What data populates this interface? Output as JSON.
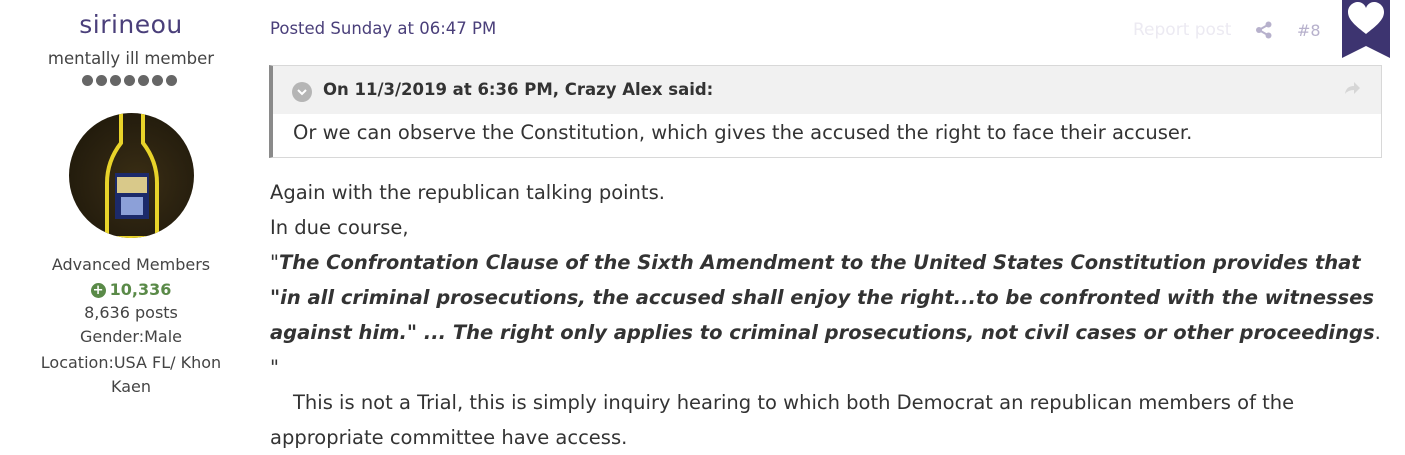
{
  "author": {
    "name": "sirineou",
    "title": "mentally ill member",
    "pips": 7,
    "group": "Advanced Members",
    "reputation": "10,336",
    "posts": "8,636 posts",
    "gender": "Gender:Male",
    "location": "Location:USA FL/ Khon Kaen"
  },
  "post": {
    "posted": "Posted Sunday at 06:47 PM",
    "report_label": "Report post",
    "number": "#8",
    "quote": {
      "citation": "On 11/3/2019 at 6:36 PM, Crazy Alex said:",
      "text": "Or we can observe the Constitution, which gives the accused the right to face their accuser."
    },
    "body": {
      "line1": "Again with the republican talking points.",
      "line2": "In due course,",
      "quote_open": "\"",
      "quote_italic": "The Confrontation Clause of the Sixth Amendment to the United States Constitution provides that \"in all criminal prosecutions, the accused shall enjoy the right...to be confronted with the witnesses against him.\" ... The right only applies to criminal prosecutions, not civil cases or other proceedings",
      "quote_close": ". \"",
      "line4": "This is not a Trial, this is simply inquiry hearing to which both Democrat an republican members of the appropriate committee have access."
    }
  },
  "colors": {
    "accent": "#4a3f7a",
    "reputation": "#5a8a48"
  },
  "icons": {
    "share": "share-icon",
    "heart": "heart-icon",
    "toggle": "chevron-down-icon",
    "quote_go": "arrow-right-icon"
  }
}
